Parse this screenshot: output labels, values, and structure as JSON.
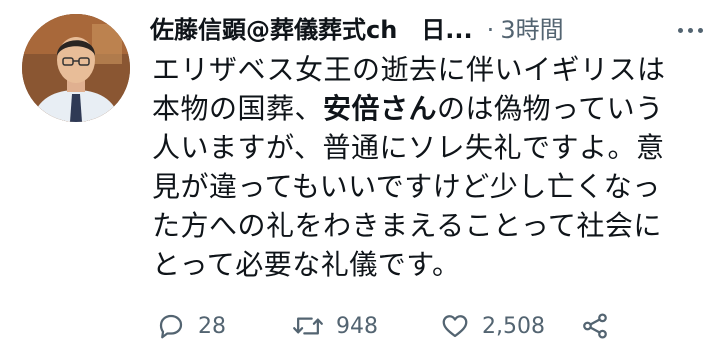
{
  "author": {
    "display_name": "佐藤信顕@葬儀葬式ch　日...",
    "time_separator": "·",
    "timestamp": "3時間"
  },
  "tweet": {
    "lines": [
      [
        "エリザベス女王の逝去に伴いイギリスは"
      ],
      [
        "本物の国葬、",
        "安倍さん",
        "のは偽物っていう"
      ],
      [
        "人いますが、普通にソレ失礼ですよ。意"
      ],
      [
        "見が違ってもいいですけど少し亡くなっ"
      ],
      [
        "た方への礼をわきまえることって社会に"
      ],
      [
        "とって必要な礼儀です。"
      ]
    ]
  },
  "actions": {
    "reply_count": "28",
    "retweet_count": "948",
    "like_count": "2,508"
  },
  "icons": {
    "more": "more-icon",
    "reply": "reply-icon",
    "retweet": "retweet-icon",
    "like": "heart-icon",
    "share": "share-icon"
  },
  "colors": {
    "text": "#0f1419",
    "muted": "#536471"
  }
}
